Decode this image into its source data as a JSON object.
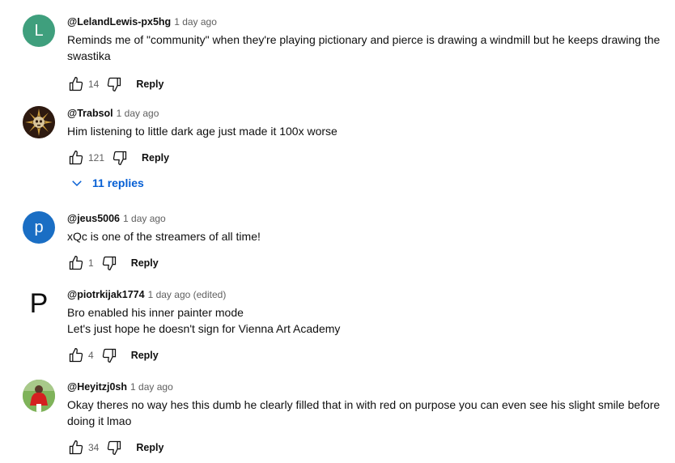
{
  "comments": [
    {
      "handle": "@LelandLewis-px5hg",
      "time": "1 day ago",
      "avatar_letter": "L",
      "lines": [
        "Reminds me of \"community\" when they're playing pictionary and pierce is drawing a windmill but he keeps drawing the",
        "swastika"
      ],
      "likes": "14",
      "reply_label": "Reply"
    },
    {
      "handle": "@Trabsol",
      "time": "1 day ago",
      "avatar_letter": "",
      "lines": [
        "Him listening to little dark age just made it 100x worse"
      ],
      "likes": "121",
      "reply_label": "Reply",
      "replies_label": "11 replies"
    },
    {
      "handle": "@jeus5006",
      "time": "1 day ago",
      "avatar_letter": "p",
      "lines": [
        "xQc is one of the streamers of all time!"
      ],
      "likes": "1",
      "reply_label": "Reply"
    },
    {
      "handle": "@piotrkijak1774",
      "time": "1 day ago (edited)",
      "avatar_letter": "P",
      "lines": [
        "Bro enabled his inner painter mode",
        "Let's just hope he doesn't sign for Vienna Art Academy"
      ],
      "likes": "4",
      "reply_label": "Reply"
    },
    {
      "handle": "@Heyitzj0sh",
      "time": "1 day ago",
      "avatar_letter": "",
      "lines": [
        "Okay theres no way hes this dumb he clearly filled that in with red on purpose you can even see his slight smile before",
        "doing it lmao"
      ],
      "likes": "34",
      "reply_label": "Reply"
    }
  ],
  "colors": {
    "link_blue": "#065fd4",
    "meta_gray": "#606060",
    "avatar_L": "#3f9f7d",
    "avatar_p": "#1a6ec4"
  },
  "icons": [
    "thumbs-up-icon",
    "thumbs-down-icon",
    "chevron-down-icon"
  ]
}
